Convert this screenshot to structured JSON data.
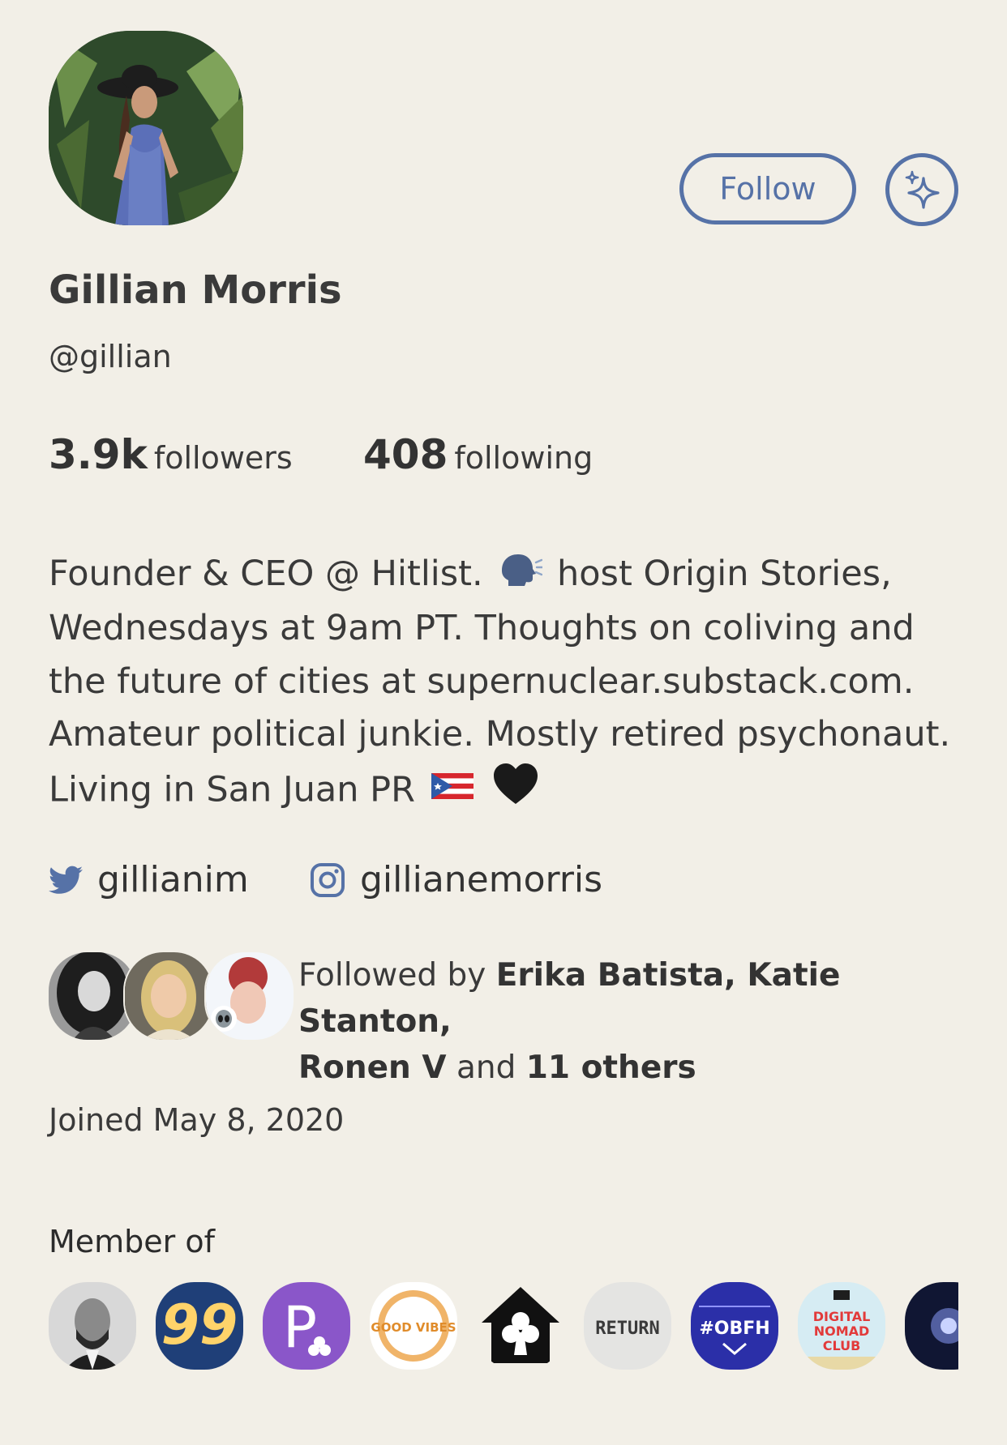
{
  "profile": {
    "name": "Gillian Morris",
    "handle": "@gillian",
    "follow_label": "Follow"
  },
  "stats": {
    "followers_count": "3.9k",
    "followers_label": "followers",
    "following_count": "408",
    "following_label": "following"
  },
  "bio": {
    "line1_a": "Founder & CEO @ Hitlist.",
    "line1_b": "host Origin Stories,",
    "line2": "Wednesdays at 9am PT. Thoughts on coliving and",
    "line3": "the future of cities at supernuclear.substack.com.",
    "line4": "Amateur political junkie. Mostly retired psychonaut.",
    "line5": "Living in San Juan PR"
  },
  "socials": {
    "twitter": "gillianim",
    "instagram": "gillianemorris"
  },
  "mutuals": {
    "prefix": "Followed by",
    "names": "Erika Batista, Katie Stanton,",
    "names2": "Ronen V",
    "and": "and",
    "others": "11 others"
  },
  "joined": "Joined May 8, 2020",
  "member_of": {
    "label": "Member of",
    "clubs": [
      "lincoln-portrait",
      "99",
      "P",
      "good vibes",
      "clubhouse",
      "RETURN",
      "#OBFH",
      "DIGITAL NOMAD CLUB",
      "blue-pattern"
    ],
    "text_99": "99",
    "text_p": "P",
    "text_vibes": "GOOD VIBES",
    "text_return": "RETURN",
    "text_obfh": "#OBFH",
    "text_dnc1": "DIGITAL",
    "text_dnc2": "NOMAD",
    "text_dnc3": "CLUB"
  },
  "colors": {
    "background": "#f2efe7",
    "accent": "#5672a7",
    "text": "#3a3a3a"
  }
}
